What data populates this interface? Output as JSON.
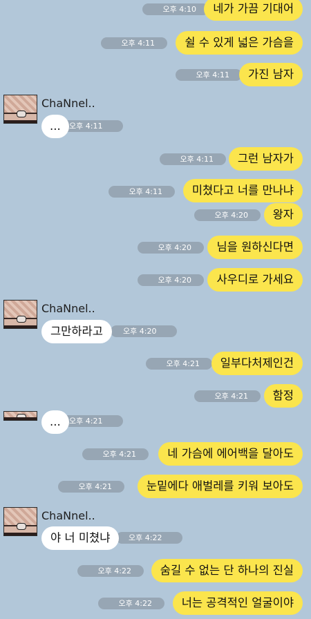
{
  "chat": {
    "sender_name": "ChaNnel..",
    "messages": [
      {
        "text": "네가 가끔 기대어",
        "time": "오후 4:10"
      },
      {
        "text": "쉴 수 있게 넓은 가슴을",
        "time": "오후 4:11"
      },
      {
        "text": "가진 남자",
        "time": "오후 4:11"
      },
      {
        "text": "...",
        "time": "오후 4:11"
      },
      {
        "text": "그런 남자가",
        "time": "오후 4:11"
      },
      {
        "text": "미쳤다고 너를 만나냐",
        "time": "오후 4:11"
      },
      {
        "text": "왕자",
        "time": "오후 4:20"
      },
      {
        "text": "님을 원하신다면",
        "time": "오후 4:20"
      },
      {
        "text": "사우디로 가세요",
        "time": "오후 4:20"
      },
      {
        "text": "그만하라고",
        "time": "오후 4:20"
      },
      {
        "text": "일부다처제인건",
        "time": "오후 4:21"
      },
      {
        "text": "함정",
        "time": "오후 4:21"
      },
      {
        "text": "...",
        "time": "오후 4:21"
      },
      {
        "text": "네 가슴에 에어백을 달아도",
        "time": "오후 4:21"
      },
      {
        "text": "눈밑에다 애벌레를 키워 보아도",
        "time": "오후 4:21"
      },
      {
        "text": "야 너 미쳤냐",
        "time": "오후 4:22"
      },
      {
        "text": "숨길 수 없는 단 하나의 진실",
        "time": "오후 4:22"
      },
      {
        "text": "너는 공격적인 얼굴이야",
        "time": "오후 4:22"
      }
    ]
  },
  "colors": {
    "background": "#b2c7d9",
    "my_bubble": "#fbe54d",
    "their_bubble": "#ffffff",
    "time_pill": "#97a6b4"
  }
}
